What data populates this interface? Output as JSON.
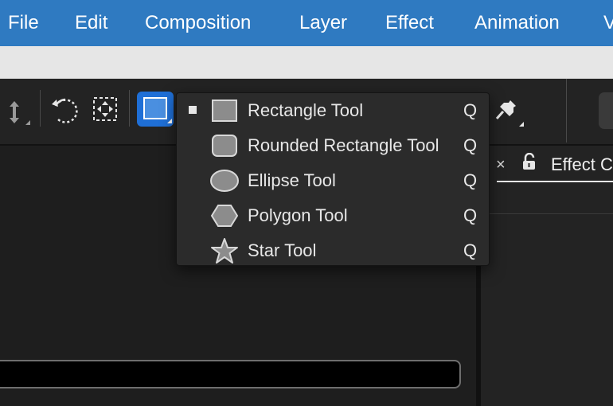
{
  "menubar": {
    "items": [
      "File",
      "Edit",
      "Composition",
      "Layer",
      "Effect",
      "Animation",
      "V"
    ]
  },
  "toolbar": {
    "tools": [
      {
        "icon": "up-down-arrow-icon"
      },
      {
        "icon": "rotate-icon"
      },
      {
        "icon": "anchor-point-icon"
      },
      {
        "icon": "rectangle-tool-icon",
        "active": true
      },
      {
        "icon": "pin-icon"
      }
    ]
  },
  "shape_menu": {
    "items": [
      {
        "label": "Rectangle Tool",
        "shortcut": "Q",
        "icon": "rectangle-icon",
        "checked": true
      },
      {
        "label": "Rounded Rectangle Tool",
        "shortcut": "Q",
        "icon": "rounded-rectangle-icon",
        "checked": false
      },
      {
        "label": "Ellipse Tool",
        "shortcut": "Q",
        "icon": "ellipse-icon",
        "checked": false
      },
      {
        "label": "Polygon Tool",
        "shortcut": "Q",
        "icon": "polygon-icon",
        "checked": false
      },
      {
        "label": "Star Tool",
        "shortcut": "Q",
        "icon": "star-icon",
        "checked": false
      }
    ]
  },
  "effect_panel": {
    "tab_label": "Effect Co",
    "close_symbol": "×"
  },
  "colors": {
    "menubar": "#2f7ac1",
    "active_tool": "#1f6fd6",
    "panel_bg": "#1e1e1e",
    "dropdown_bg": "#2b2b2b"
  }
}
